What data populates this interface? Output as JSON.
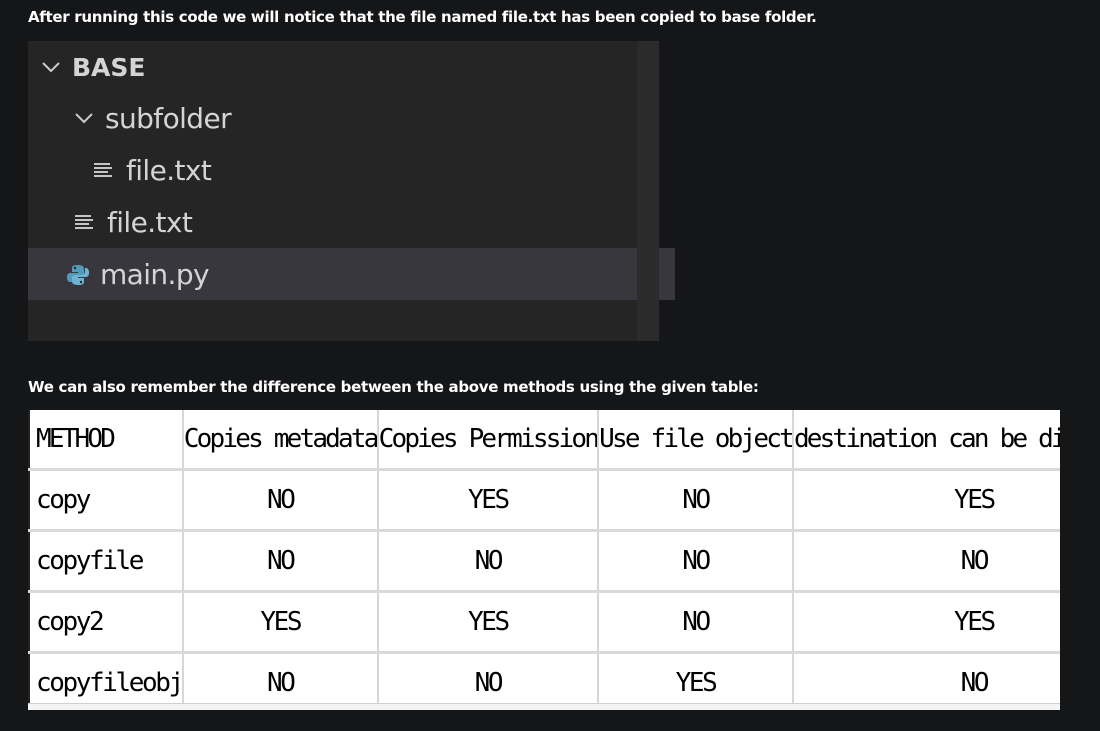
{
  "text": {
    "intro": "After running this code we will notice that the file named file.txt has been copied to base folder.",
    "table_intro": "We can also remember the difference between the above methods using the given table:"
  },
  "explorer": {
    "root": "BASE",
    "subfolder": "subfolder",
    "subfolder_file": "file.txt",
    "file": "file.txt",
    "main": "main.py",
    "colors": {
      "python_icon": "#519aba",
      "selected_row": "#37373d",
      "background": "#252526"
    }
  },
  "table": {
    "headers": [
      "METHOD",
      "Copies metadata",
      "Copies Permission",
      "Use file object",
      "destination can be directory"
    ],
    "rows": [
      [
        "copy",
        "NO",
        "YES",
        "NO",
        "YES"
      ],
      [
        "copyfile",
        "NO",
        "NO",
        "NO",
        "NO"
      ],
      [
        "copy2",
        "YES",
        "YES",
        "NO",
        "YES"
      ],
      [
        "copyfileobj",
        "NO",
        "NO",
        "YES",
        "NO"
      ]
    ]
  }
}
